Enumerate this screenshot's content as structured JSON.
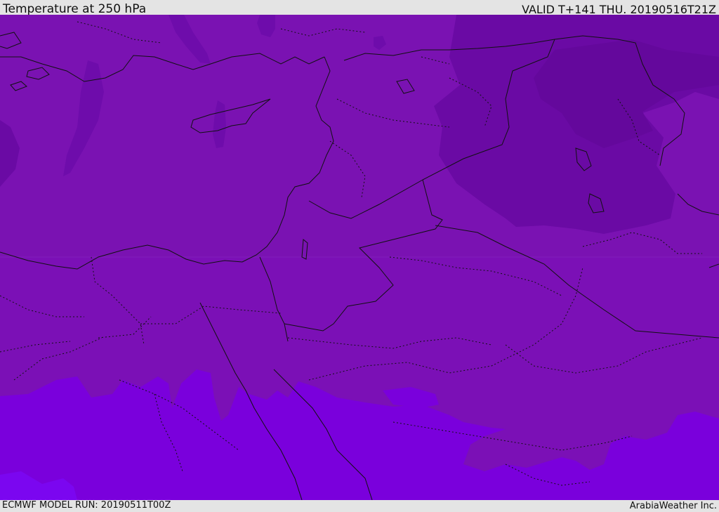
{
  "header": {
    "title": "Temperature at 250 hPa",
    "valid": "VALID T+141 THU. 20190516T21Z"
  },
  "footer": {
    "model_run": "ECMWF MODEL RUN: 20190511T00Z",
    "credit": "ArabiaWeather Inc."
  },
  "colors": {
    "field_main": "#7a12b2",
    "field_cold": "#6a0aa4",
    "field_warm": "#7e10b8",
    "field_warmer": "#7a00dc",
    "field_warmest": "#7b06f0",
    "border_line": "#111111",
    "coast_line": "#111111"
  },
  "map": {
    "field": "Temperature",
    "level": "250 hPa"
  }
}
